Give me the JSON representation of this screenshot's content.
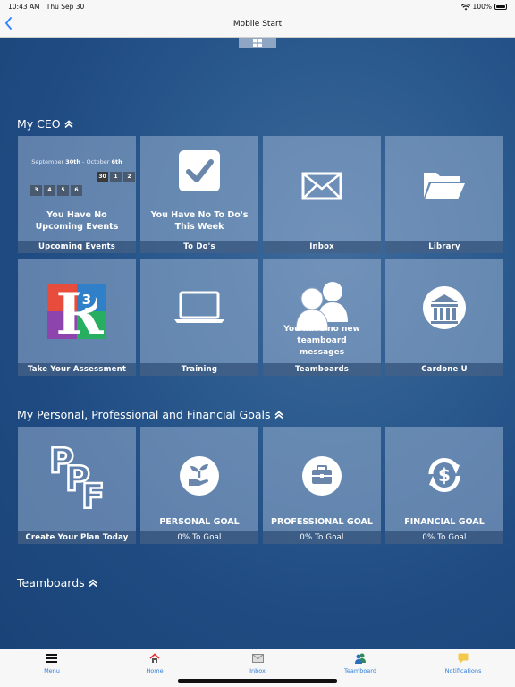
{
  "status_bar": {
    "time": "10:43 AM",
    "date": "Thu Sep 30",
    "battery": "100%"
  },
  "nav": {
    "title": "Mobile Start"
  },
  "sections": {
    "my_ceo": {
      "title": "My CEO"
    },
    "goals": {
      "title": "My Personal, Professional and Financial Goals"
    },
    "teamboards": {
      "title": "Teamboards"
    }
  },
  "my_ceo_tiles": {
    "events": {
      "label": "Upcoming Events",
      "range_start": "September ",
      "range_start_day": "30th",
      "range_sep": " - October ",
      "range_end_day": "6th",
      "days": [
        "30",
        "1",
        "2",
        "3",
        "4",
        "5",
        "6"
      ],
      "message_line1": "You Have No",
      "message_line2": "Upcoming Events"
    },
    "todos": {
      "label": "To Do's",
      "message_line1": "You Have No To Do's",
      "message_line2": "This Week"
    },
    "inbox": {
      "label": "Inbox"
    },
    "library": {
      "label": "Library"
    },
    "assessment": {
      "label": "Take Your Assessment",
      "logo_letter": "R",
      "logo_number": "3"
    },
    "training": {
      "label": "Training"
    },
    "teamboards": {
      "label": "Teamboards",
      "message_line1": "You have no new",
      "message_line2": "teamboard",
      "message_line3": "messages"
    },
    "cardone_u": {
      "label": "Cardone U"
    }
  },
  "goal_tiles": {
    "plan": {
      "label": "Create Your Plan Today",
      "logo_text": "PPF"
    },
    "personal": {
      "name": "PERSONAL GOAL",
      "progress": "0% To Goal"
    },
    "professional": {
      "name": "PROFESSIONAL GOAL",
      "progress": "0% To Goal"
    },
    "financial": {
      "name": "FINANCIAL GOAL",
      "progress": "0% To Goal"
    }
  },
  "tab_bar": {
    "menu": "Menu",
    "home": "Home",
    "inbox": "Inbox",
    "teamboard": "Teamboard",
    "notifications": "Notifications"
  },
  "colors": {
    "accent": "#2f7fd8",
    "background": "#1e4a80",
    "tile": "#8ea6c4"
  }
}
